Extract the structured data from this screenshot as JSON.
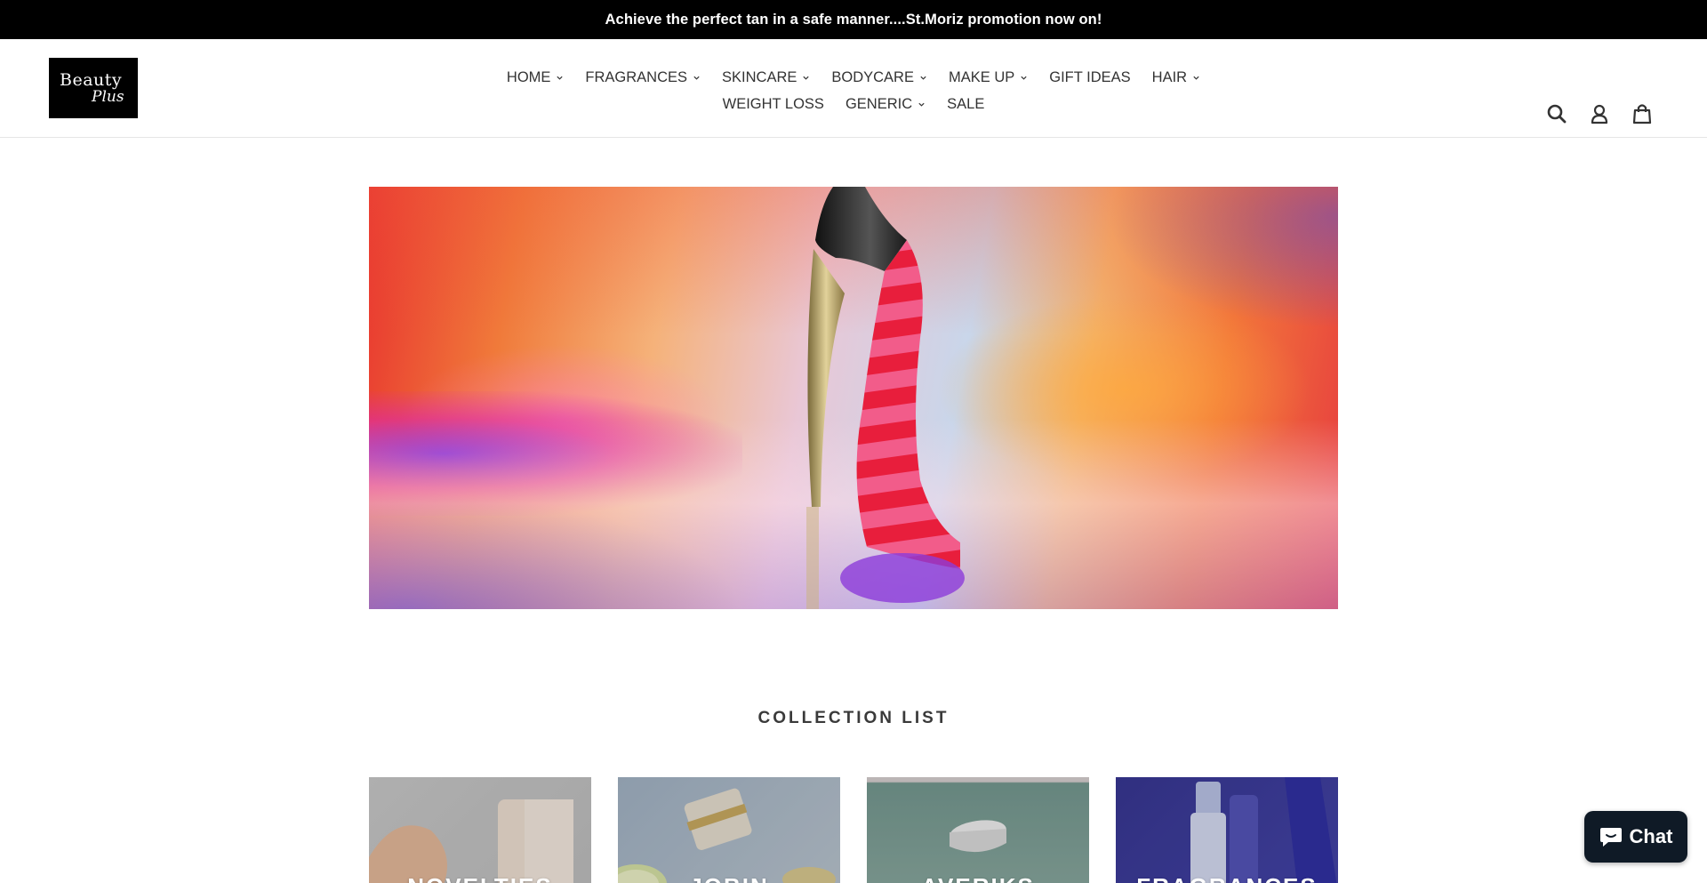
{
  "announcement": {
    "text": "Achieve the perfect tan in a safe manner....St.Moriz promotion now on!"
  },
  "logo": {
    "line1": "Beauty",
    "line2": "Plus"
  },
  "nav": {
    "row1": [
      {
        "label": "HOME",
        "dropdown": true
      },
      {
        "label": "FRAGRANCES",
        "dropdown": true
      },
      {
        "label": "SKINCARE",
        "dropdown": true
      },
      {
        "label": "BODYCARE",
        "dropdown": true
      },
      {
        "label": "MAKE UP",
        "dropdown": true
      },
      {
        "label": "GIFT IDEAS",
        "dropdown": false
      },
      {
        "label": "HAIR",
        "dropdown": true
      }
    ],
    "row2": [
      {
        "label": "WEIGHT LOSS",
        "dropdown": false
      },
      {
        "label": "GENERIC",
        "dropdown": true
      },
      {
        "label": "SALE",
        "dropdown": false
      }
    ]
  },
  "header_icons": [
    "search-icon",
    "account-icon",
    "cart-icon"
  ],
  "collections": {
    "title": "COLLECTION LIST",
    "items": [
      {
        "label": "NOVELTIES"
      },
      {
        "label": "JOBIN"
      },
      {
        "label": "AVERIKS"
      },
      {
        "label": "FRAGRANCES"
      }
    ]
  },
  "chat": {
    "label": "Chat",
    "icon": "chat-bubble-icon"
  },
  "colors": {
    "announcement_bg": "#000000",
    "chat_bg": "#0f1a26"
  }
}
